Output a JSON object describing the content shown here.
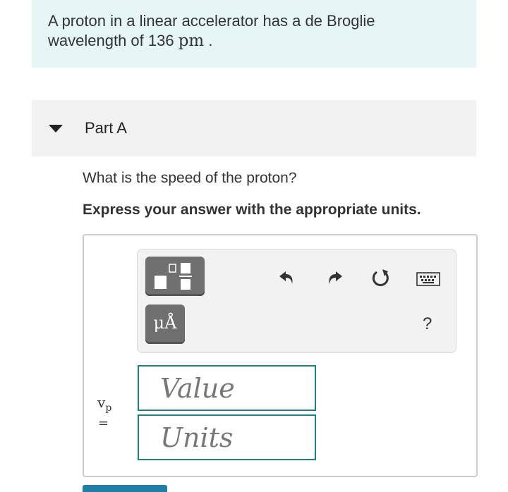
{
  "prompt": {
    "text_before": "A proton in a linear accelerator has a de Broglie wavelength of 136 ",
    "unit": "pm",
    "text_after": " ."
  },
  "part": {
    "label": "Part A",
    "question": "What is the speed of the proton?",
    "instruction": "Express your answer with the appropriate units."
  },
  "toolbar": {
    "icons": [
      "fraction-template-icon",
      "units-template-icon",
      "undo-icon",
      "redo-icon",
      "reset-icon",
      "keyboard-icon",
      "help-icon"
    ],
    "units_glyph": "μÅ",
    "help": "?"
  },
  "answer": {
    "variable": "v",
    "subscript": "p",
    "equals": "=",
    "value_placeholder": "Value",
    "units_placeholder": "Units"
  },
  "colors": {
    "prompt_bg": "#e6f5f5",
    "field_border": "#1f7f82",
    "template_button": "#6f6f6f"
  }
}
